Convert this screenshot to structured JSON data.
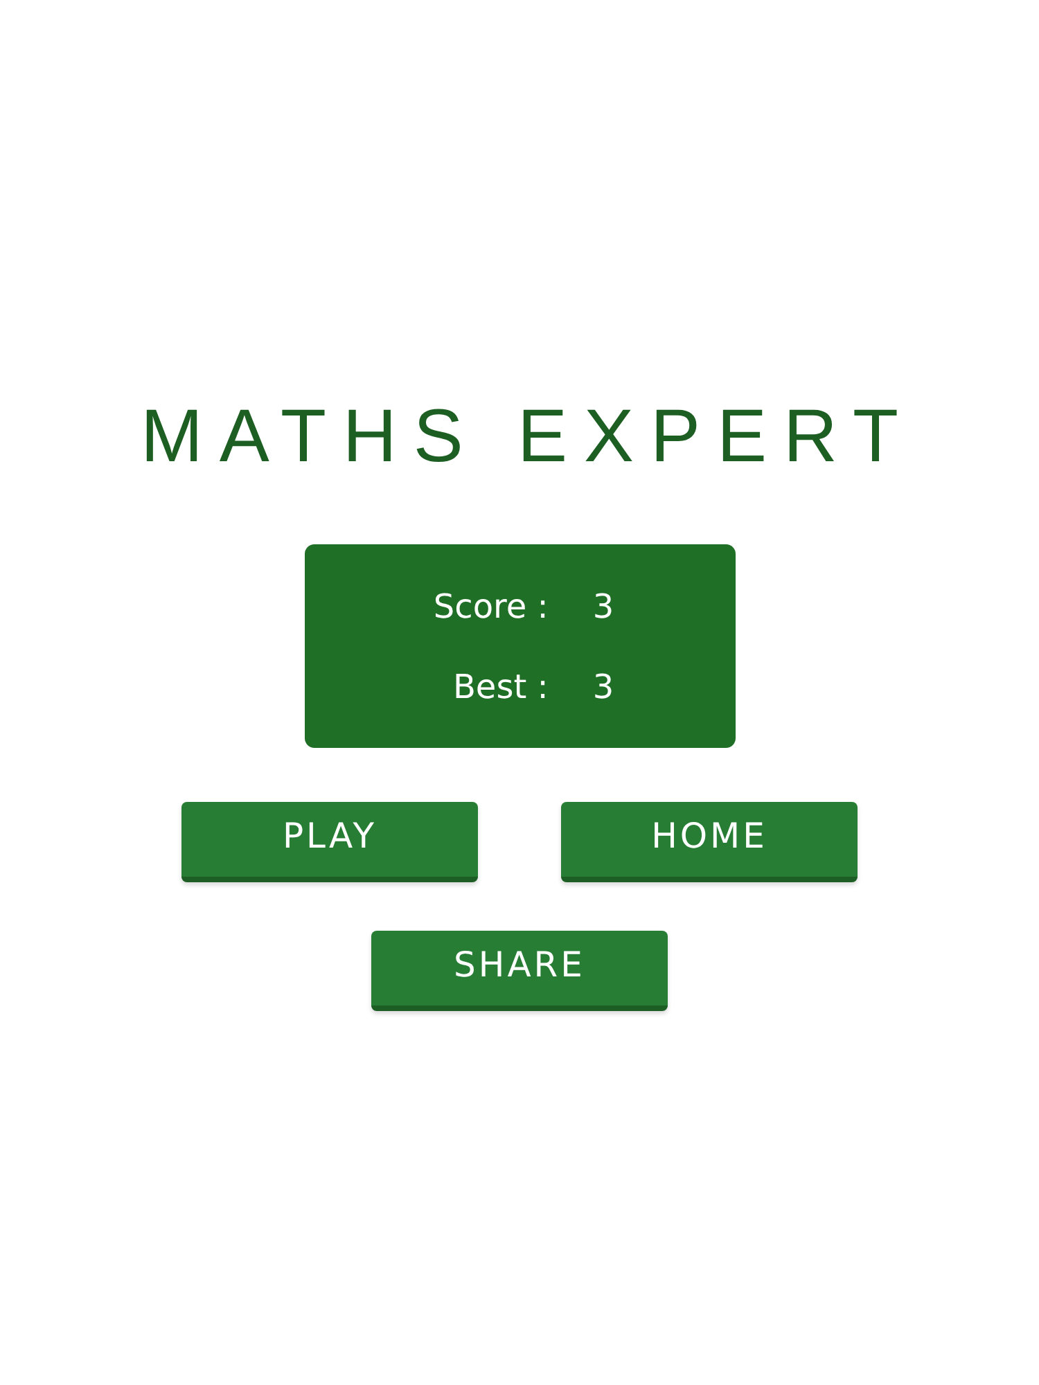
{
  "title": "MATHS EXPERT",
  "score_panel": {
    "rows": [
      {
        "label": "Score :",
        "value": "3"
      },
      {
        "label": "Best :",
        "value": "3"
      }
    ]
  },
  "buttons": [
    "PLAY",
    "HOME",
    "SHARE"
  ]
}
